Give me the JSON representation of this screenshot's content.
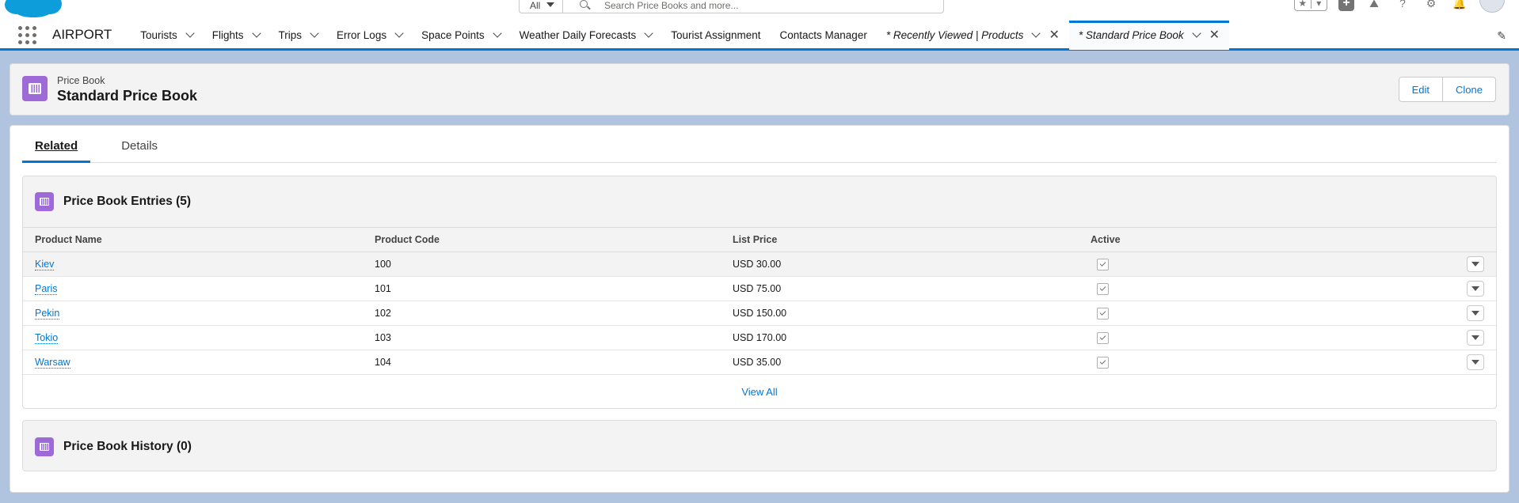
{
  "search": {
    "scope": "All",
    "placeholder": "Search Price Books and more..."
  },
  "nav": {
    "app_name": "AIRPORT",
    "items": [
      {
        "label": "Tourists"
      },
      {
        "label": "Flights"
      },
      {
        "label": "Trips"
      },
      {
        "label": "Error Logs"
      },
      {
        "label": "Space Points"
      },
      {
        "label": "Weather Daily Forecasts"
      },
      {
        "label": "Tourist Assignment"
      },
      {
        "label": "Contacts Manager"
      }
    ],
    "workspace_tabs": [
      {
        "label": "* Recently Viewed | Products"
      },
      {
        "label": "* Standard Price Book"
      }
    ]
  },
  "record": {
    "object_type": "Price Book",
    "title": "Standard Price Book",
    "actions": {
      "edit": "Edit",
      "clone": "Clone"
    }
  },
  "tabs": {
    "related": "Related",
    "details": "Details"
  },
  "entries": {
    "title": "Price Book Entries (5)",
    "columns": [
      "Product Name",
      "Product Code",
      "List Price",
      "Active"
    ],
    "rows": [
      {
        "name": "Kiev",
        "code": "100",
        "price": "USD 30.00"
      },
      {
        "name": "Paris",
        "code": "101",
        "price": "USD 75.00"
      },
      {
        "name": "Pekin",
        "code": "102",
        "price": "USD 150.00"
      },
      {
        "name": "Tokio",
        "code": "103",
        "price": "USD 170.00"
      },
      {
        "name": "Warsaw",
        "code": "104",
        "price": "USD 35.00"
      }
    ],
    "view_all": "View All"
  },
  "history": {
    "title": "Price Book History (0)"
  },
  "colors": {
    "brand": "#0176d3",
    "icon_purple": "#9e6ad8",
    "page_bg": "#b0c4df"
  }
}
